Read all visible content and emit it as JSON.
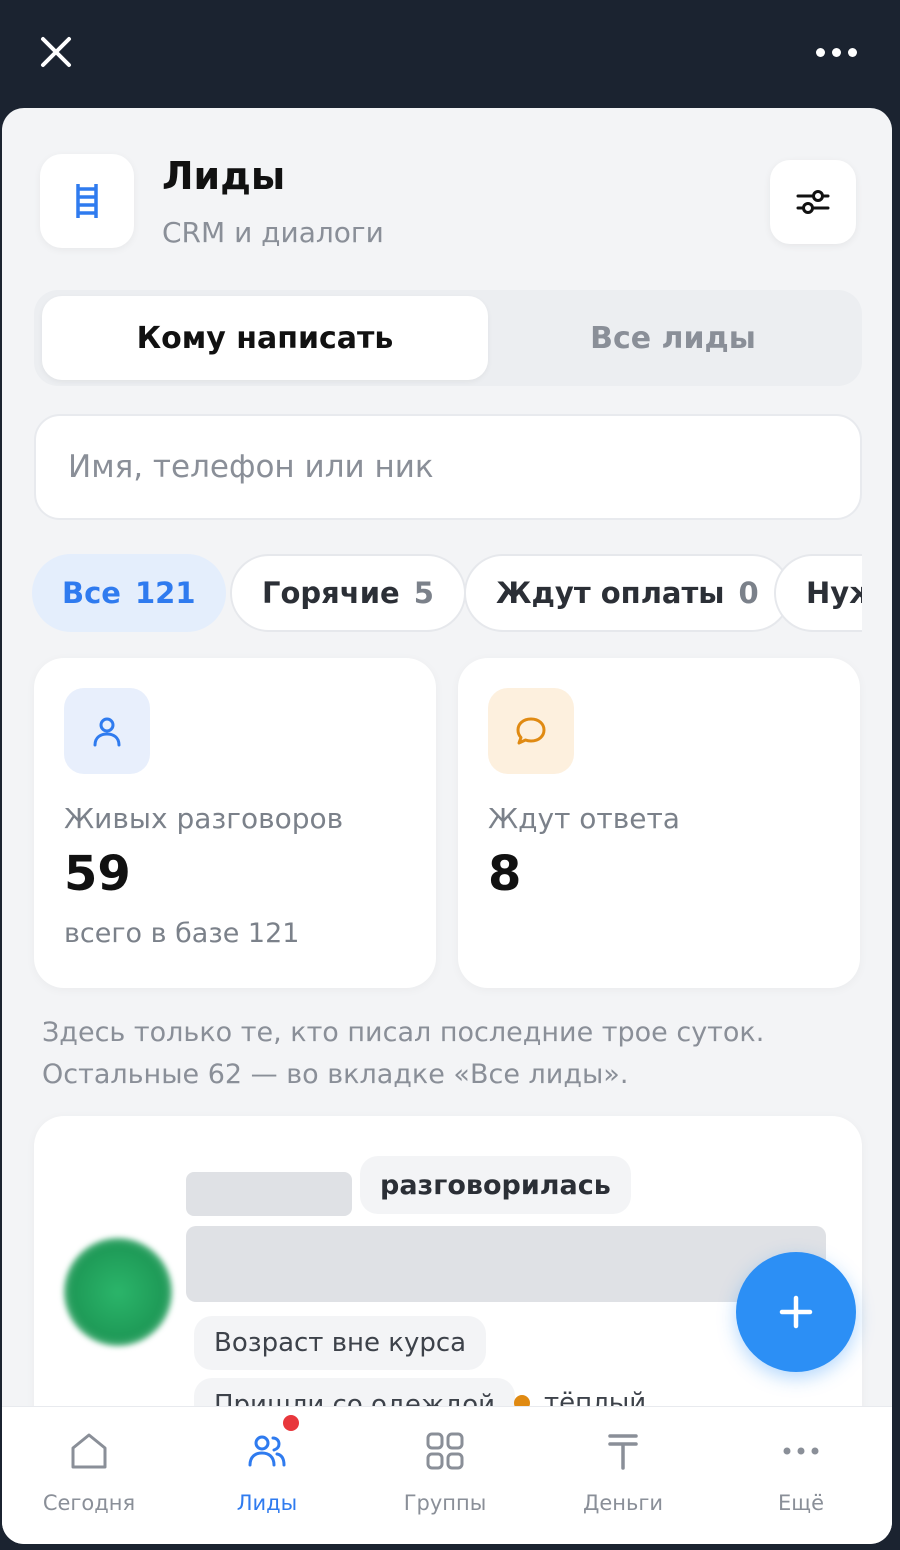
{
  "header": {
    "title": "Лиды",
    "subtitle": "CRM и диалоги"
  },
  "tabs": [
    {
      "label": "Кому написать",
      "active": true
    },
    {
      "label": "Все лиды",
      "active": false
    }
  ],
  "search": {
    "placeholder": "Имя, телефон или ник"
  },
  "chips": [
    {
      "label": "Все",
      "count": "121",
      "selected": true
    },
    {
      "label": "Горячие",
      "count": "5",
      "selected": false
    },
    {
      "label": "Ждут оплаты",
      "count": "0",
      "selected": false
    },
    {
      "label": "Нуж",
      "count": "",
      "selected": false
    }
  ],
  "stats": [
    {
      "label": "Живых разговоров",
      "value": "59",
      "sub": "всего в базе 121",
      "icon": "user-icon",
      "color": "#2f7bef"
    },
    {
      "label": "Ждут ответа",
      "value": "8",
      "sub": "",
      "icon": "chat-bubble-icon",
      "color": "#e08a12"
    }
  ],
  "note": "Здесь только те, кто писал последние трое суток. Остальные 62 — во вкладке «Все лиды».",
  "lead": {
    "status": "разговорилась",
    "tags": [
      "Возраст вне курса",
      "Пришли со одеждой"
    ],
    "temperature": "тёплый"
  },
  "bottom_nav": [
    {
      "label": "Сегодня",
      "icon": "home-icon",
      "active": false
    },
    {
      "label": "Лиды",
      "icon": "people-icon",
      "active": true,
      "badge": true
    },
    {
      "label": "Группы",
      "icon": "grid-icon",
      "active": false
    },
    {
      "label": "Деньги",
      "icon": "tenge-icon",
      "active": false
    },
    {
      "label": "Ещё",
      "icon": "more-icon",
      "active": false
    }
  ],
  "colors": {
    "accent": "#2f7bef",
    "fab": "#2c8ff5",
    "warm": "#e08a12",
    "badge": "#e8373c"
  }
}
